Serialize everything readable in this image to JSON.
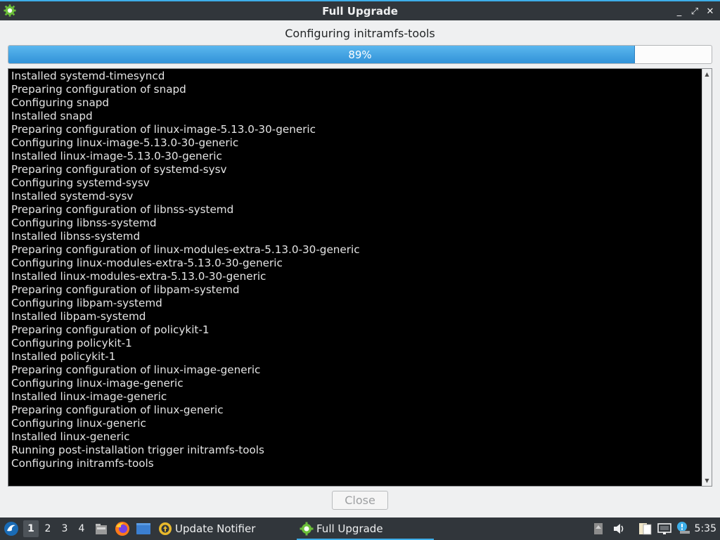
{
  "window": {
    "title": "Full Upgrade",
    "controls": {
      "minimize": "_",
      "maximize": "⤢",
      "close": "✕"
    }
  },
  "dialog": {
    "status": "Configuring initramfs-tools",
    "progress_percent": 89,
    "progress_label": "89%",
    "log_lines": [
      "Installed systemd-timesyncd",
      "Preparing configuration of snapd",
      "Configuring snapd",
      "Installed snapd",
      "Preparing configuration of linux-image-5.13.0-30-generic",
      "Configuring linux-image-5.13.0-30-generic",
      "Installed linux-image-5.13.0-30-generic",
      "Preparing configuration of systemd-sysv",
      "Configuring systemd-sysv",
      "Installed systemd-sysv",
      "Preparing configuration of libnss-systemd",
      "Configuring libnss-systemd",
      "Installed libnss-systemd",
      "Preparing configuration of linux-modules-extra-5.13.0-30-generic",
      "Configuring linux-modules-extra-5.13.0-30-generic",
      "Installed linux-modules-extra-5.13.0-30-generic",
      "Preparing configuration of libpam-systemd",
      "Configuring libpam-systemd",
      "Installed libpam-systemd",
      "Preparing configuration of policykit-1",
      "Configuring policykit-1",
      "Installed policykit-1",
      "Preparing configuration of linux-image-generic",
      "Configuring linux-image-generic",
      "Installed linux-image-generic",
      "Preparing configuration of linux-generic",
      "Configuring linux-generic",
      "Installed linux-generic",
      "Running post-installation trigger initramfs-tools",
      "Configuring initramfs-tools"
    ],
    "close_label": "Close"
  },
  "taskbar": {
    "desktops": [
      "1",
      "2",
      "3",
      "4"
    ],
    "active_desktop": "1",
    "tasks": [
      {
        "label": "Update Notifier",
        "icon": "update-notifier-icon"
      },
      {
        "label": "Full Upgrade",
        "icon": "gear-icon"
      }
    ],
    "clock": "5:35"
  },
  "colors": {
    "accent": "#3daee9",
    "titlebar": "#31363b",
    "terminal_bg": "#000000",
    "terminal_text": "#e4e4e4"
  }
}
